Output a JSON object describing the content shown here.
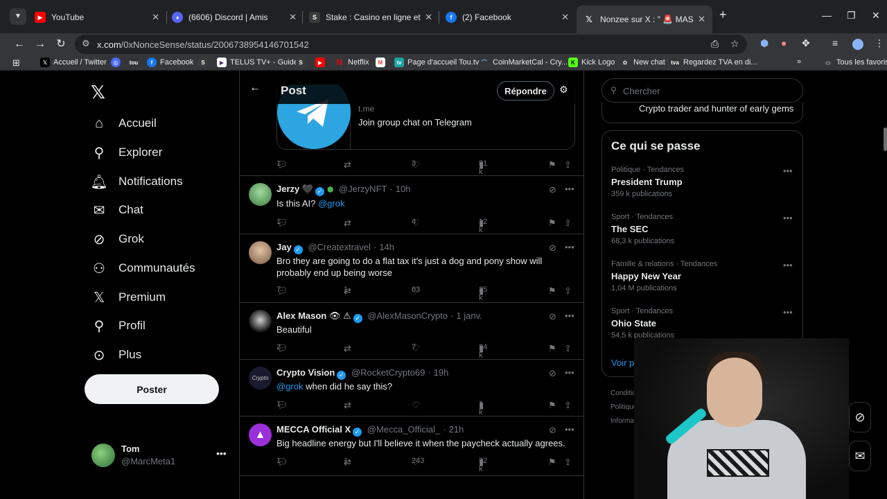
{
  "browser": {
    "tabs": [
      {
        "label": "YouTube",
        "favicon": "youtube-icon",
        "color": "#ff0000"
      },
      {
        "label": "(6606) Discord | Amis",
        "favicon": "discord-icon",
        "color": "#5865f2"
      },
      {
        "label": "Stake : Casino en ligne et Paris",
        "favicon": "stake-icon",
        "color": "#3a3a3a"
      },
      {
        "label": "(2) Facebook",
        "favicon": "facebook-icon",
        "color": "#1877f2"
      },
      {
        "label": "Nonzee sur X : \" 🚨 MASSIVE N",
        "favicon": "x-icon",
        "color": "#000000"
      }
    ],
    "url_host": "x.com",
    "url_path": "/0xNonceSense/status/2006738954146701542",
    "bookmarks": [
      {
        "label": "",
        "icon": "apps-grid-icon"
      },
      {
        "label": "Accueil / Twitter",
        "icon": "x-icon",
        "color": "#000000"
      },
      {
        "label": "",
        "icon": "circle-app-icon",
        "color": "#4a6cf7"
      },
      {
        "label": "",
        "icon": "tou-tv-icon",
        "color": "#333333"
      },
      {
        "label": "Facebook",
        "icon": "facebook-icon",
        "color": "#1877f2"
      },
      {
        "label": "",
        "icon": "stake-icon",
        "color": "#3a3a3a"
      },
      {
        "label": "TELUS TV+ - Guide",
        "icon": "telus-icon",
        "color": "#ffffff"
      },
      {
        "label": "",
        "icon": "stake-icon",
        "color": "#3a3a3a"
      },
      {
        "label": "",
        "icon": "youtube-icon",
        "color": "#ff0000"
      },
      {
        "label": "Netflix",
        "icon": "netflix-icon",
        "color": "#e50914"
      },
      {
        "label": "",
        "icon": "gmail-icon",
        "color": "#ea4335"
      },
      {
        "label": "Page d'accueil Tou.tv",
        "icon": "toutv-icon",
        "color": "#19a4a4"
      },
      {
        "label": "CoinMarketCal - Cry...",
        "icon": "coinmarketcal-icon",
        "color": "#2962ff"
      },
      {
        "label": "Kick Logo",
        "icon": "kick-icon",
        "color": "#53fc18"
      },
      {
        "label": "New chat",
        "icon": "openai-icon",
        "color": "#444444"
      },
      {
        "label": "Regardez TVA en di...",
        "icon": "tva-icon",
        "color": "#333333"
      }
    ],
    "all_bookmarks": "Tous les favoris"
  },
  "nav": {
    "items": [
      {
        "label": "Accueil",
        "icon": "home-icon"
      },
      {
        "label": "Explorer",
        "icon": "search-icon"
      },
      {
        "label": "Notifications",
        "icon": "bell-icon"
      },
      {
        "label": "Chat",
        "icon": "mail-icon"
      },
      {
        "label": "Grok",
        "icon": "grok-icon"
      },
      {
        "label": "Communautés",
        "icon": "people-icon"
      },
      {
        "label": "Premium",
        "icon": "x-icon"
      },
      {
        "label": "Profil",
        "icon": "person-icon"
      },
      {
        "label": "Plus",
        "icon": "more-circle-icon"
      }
    ],
    "post_button": "Poster",
    "account": {
      "name": "Tom",
      "handle": "@MarcMeta1"
    }
  },
  "header": {
    "title": "Post",
    "reply_button": "Répondre"
  },
  "card": {
    "domain": "t.me",
    "title": "Join group chat on Telegram"
  },
  "main_stats": {
    "replies": "1",
    "retweets": "",
    "likes": "3",
    "views": "81 k"
  },
  "replies": [
    {
      "name": "Jerzy",
      "badges": "🖤",
      "handle": "@JerzyNFT",
      "time": "10h",
      "text_parts": [
        {
          "t": "Is this AI? "
        },
        {
          "t": "@grok",
          "mention": true
        }
      ],
      "replies": "1",
      "retweets": "",
      "likes": "4",
      "views": "12 k",
      "avatar_color": "#7ac57a"
    },
    {
      "name": "Jay",
      "badges": "",
      "handle": "@Creatextravel",
      "time": "14h",
      "text_parts": [
        {
          "t": "Bro they are going to do a flat tax it's just a dog and pony show will probably end up being worse"
        }
      ],
      "replies": "7",
      "retweets": "1",
      "likes": "83",
      "views": "25 k",
      "avatar_color": "#c9a98a"
    },
    {
      "name": "Alex Mason",
      "badges": "👁 ⚠",
      "handle": "@AlexMasonCrypto",
      "time": "1 janv.",
      "text_parts": [
        {
          "t": "Beautiful"
        }
      ],
      "replies": "2",
      "retweets": "",
      "likes": "7",
      "views": "24 k",
      "avatar_color": "#2e2e2e"
    },
    {
      "name": "Crypto Vision",
      "badges": "",
      "handle": "@RocketCrypto69",
      "time": "19h",
      "text_parts": [
        {
          "t": "@grok",
          "mention": true
        },
        {
          "t": " when did he say this?"
        }
      ],
      "replies": "1",
      "retweets": "",
      "likes": "",
      "views": "1 k",
      "avatar_color": "#1a1a2e"
    },
    {
      "name": "MECCA Official X",
      "badges": "",
      "handle": "@Mecca_Official_",
      "time": "21h",
      "text_parts": [
        {
          "t": "Big headline energy but I'll believe it when the paycheck actually agrees."
        }
      ],
      "replies": "1",
      "retweets": "1",
      "likes": "243",
      "views": "32 k",
      "avatar_color": "#9b30d9"
    }
  ],
  "right": {
    "search_placeholder": "Chercher",
    "bio_snippet": "Crypto trader and hunter of early gems",
    "trends_title": "Ce qui se passe",
    "trends": [
      {
        "category": "Politique · Tendances",
        "title": "President Trump",
        "count": "359 k publications"
      },
      {
        "category": "Sport · Tendances",
        "title": "The SEC",
        "count": "68,3 k publications"
      },
      {
        "category": "Famille & relations · Tendances",
        "title": "Happy New Year",
        "count": "1,04 M publications"
      },
      {
        "category": "Sport · Tendances",
        "title": "Ohio State",
        "count": "54,5 k publications"
      }
    ],
    "show_more": "Voir pl",
    "footer": [
      "Conditio",
      "Politique",
      "Informat"
    ]
  },
  "colors": {
    "accent": "#1d9bf0",
    "background": "#000000",
    "border": "#2f3336",
    "muted": "#71767b"
  }
}
